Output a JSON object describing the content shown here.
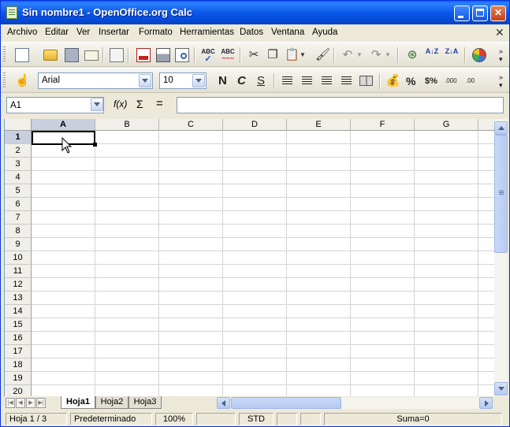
{
  "window": {
    "title": "Sin nombre1 - OpenOffice.org Calc",
    "controls": [
      "minimize",
      "maximize",
      "close"
    ]
  },
  "menu": {
    "items": [
      "Archivo",
      "Editar",
      "Ver",
      "Insertar",
      "Formato",
      "Herramientas",
      "Datos",
      "Ventana",
      "Ayuda"
    ]
  },
  "toolbar_standard": {
    "icons": [
      "new-document-icon",
      "open-folder-icon",
      "save-disk-icon",
      "email-icon",
      "edit-file-icon",
      "export-pdf-icon",
      "print-icon",
      "print-preview-icon",
      "spellcheck-icon",
      "autospell-icon",
      "cut-icon",
      "copy-icon",
      "paste-icon",
      "format-paintbrush-icon",
      "undo-icon",
      "redo-icon",
      "navigator-icon",
      "sort-ascending-icon",
      "sort-descending-icon",
      "chart-icon"
    ],
    "spell_label": "ABC",
    "sort_az": "A↓Z",
    "sort_za": "Z↓A"
  },
  "toolbar_formatting": {
    "font_name": "Arial",
    "font_size": "10",
    "bold": "N",
    "italic": "C",
    "underline": "S",
    "currency": "$%",
    "percent": "%",
    "decimal_add": ".000",
    "decimal_remove": ".00"
  },
  "formula_bar": {
    "name_box": "A1",
    "function_wizard": "f(x)",
    "sum": "Σ",
    "equals": "=",
    "formula": ""
  },
  "grid": {
    "columns": [
      "A",
      "B",
      "C",
      "D",
      "E",
      "F",
      "G"
    ],
    "rows": [
      "1",
      "2",
      "3",
      "4",
      "5",
      "6",
      "7",
      "8",
      "9",
      "10",
      "11",
      "12",
      "13",
      "14",
      "15",
      "16",
      "17",
      "18",
      "19",
      "20"
    ],
    "active_cell": "A1"
  },
  "sheets": {
    "tabs": [
      "Hoja1",
      "Hoja2",
      "Hoja3"
    ],
    "active": "Hoja1"
  },
  "status_bar": {
    "sheet": "Hoja 1 / 3",
    "page_style": "Predeterminado",
    "zoom": "100%",
    "selection_mode": "STD",
    "sum": "Suma=0"
  }
}
